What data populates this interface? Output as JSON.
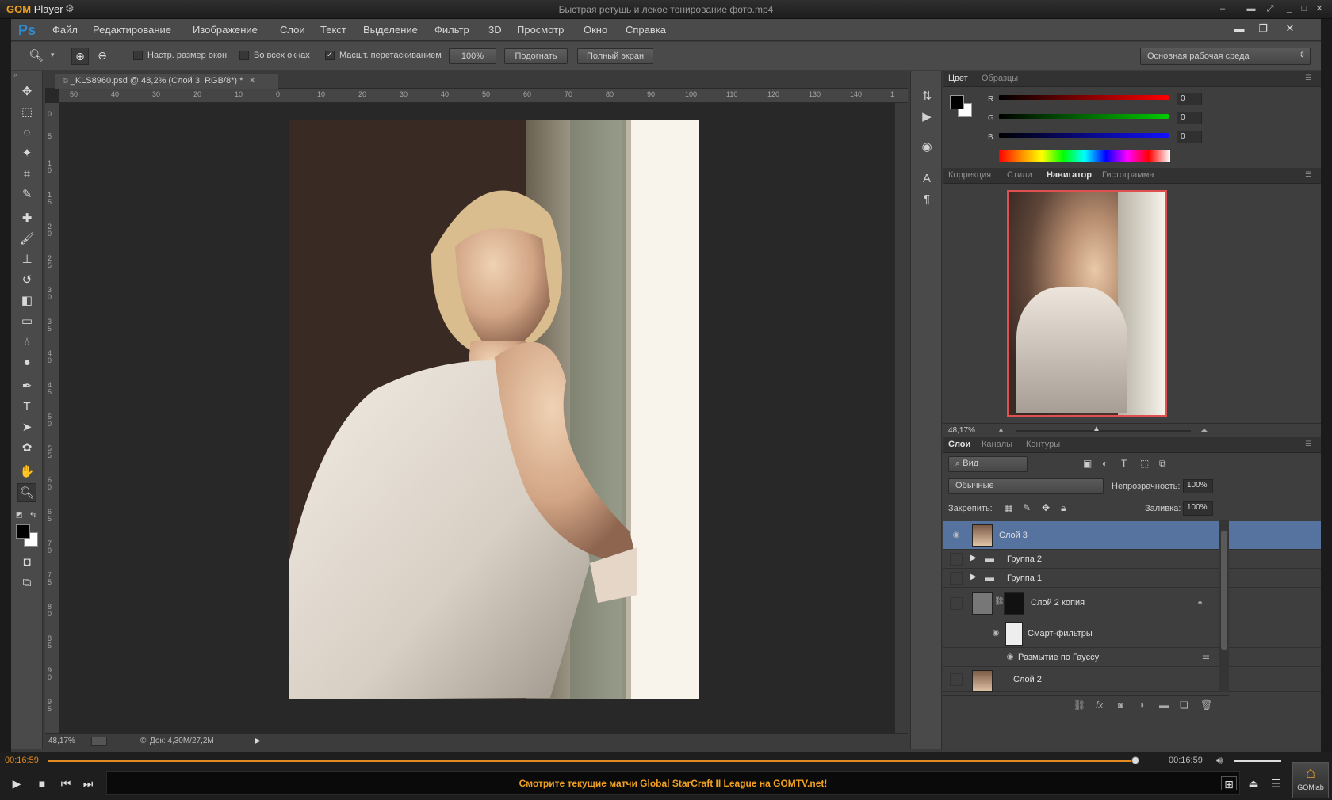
{
  "player": {
    "brand": "GOM",
    "brand_suffix": "Player",
    "file_title": "Быстрая ретушь и лекое тонирование фото.mp4",
    "time_current": "00:16:59",
    "time_total": "00:16:59",
    "ad_text": "Смотрите текущие матчи Global StarCraft II League на GOMTV.net!",
    "lab_label": "GOMlab",
    "progress": 0.98
  },
  "ps": {
    "logo": "Ps",
    "menu": [
      "Файл",
      "Редактирование",
      "Изображение",
      "Слои",
      "Текст",
      "Выделение",
      "Фильтр",
      "3D",
      "Просмотр",
      "Окно",
      "Справка"
    ],
    "options": {
      "resize_windows": "Настр. размер окон",
      "all_windows": "Во всех окнах",
      "scrubby_zoom": "Масшт. перетаскиванием",
      "btn_100": "100%",
      "btn_fit": "Подогнать",
      "btn_fullscreen": "Полный экран",
      "workspace": "Основная рабочая среда"
    },
    "doc_tab": "_KLS8960.psd @ 48,2% (Слой 3, RGB/8*) *",
    "hruler": [
      "50",
      "40",
      "30",
      "20",
      "10",
      "0",
      "10",
      "20",
      "30",
      "40",
      "50",
      "60",
      "70",
      "80",
      "90",
      "100",
      "110",
      "120",
      "130",
      "140",
      "1"
    ],
    "vruler": [
      "0",
      "5",
      "1 0",
      "1 5",
      "2 0",
      "2 5",
      "3 0",
      "3 5",
      "4 0",
      "4 5",
      "5 0",
      "5 5",
      "6 0",
      "6 5",
      "7 0",
      "7 5",
      "8 0",
      "8 5",
      "9 0",
      "9 5"
    ],
    "status": {
      "zoom": "48,17%",
      "doc": "Док: 4,30M/27,2M"
    },
    "color_panel": {
      "tabs": [
        "Цвет",
        "Образцы"
      ],
      "r_label": "R",
      "g_label": "G",
      "b_label": "B",
      "r": "0",
      "g": "0",
      "b": "0"
    },
    "nav_panel": {
      "tabs": [
        "Коррекция",
        "Стили",
        "Навигатор",
        "Гистограмма"
      ],
      "zoom": "48,17%"
    },
    "layers_panel": {
      "tabs": [
        "Слои",
        "Каналы",
        "Контуры"
      ],
      "filter": "Вид",
      "blend": "Обычные",
      "opacity_label": "Непрозрачность:",
      "opacity": "100%",
      "lock_label": "Закрепить:",
      "fill_label": "Заливка:",
      "fill": "100%",
      "layers": {
        "l1": "Слой 3",
        "l2": "Группа 2",
        "l3": "Группа 1",
        "l4": "Слой 2 копия",
        "l5": "Смарт-фильтры",
        "l6": "Размытие по Гауссу",
        "l7": "Слой 2"
      }
    }
  }
}
